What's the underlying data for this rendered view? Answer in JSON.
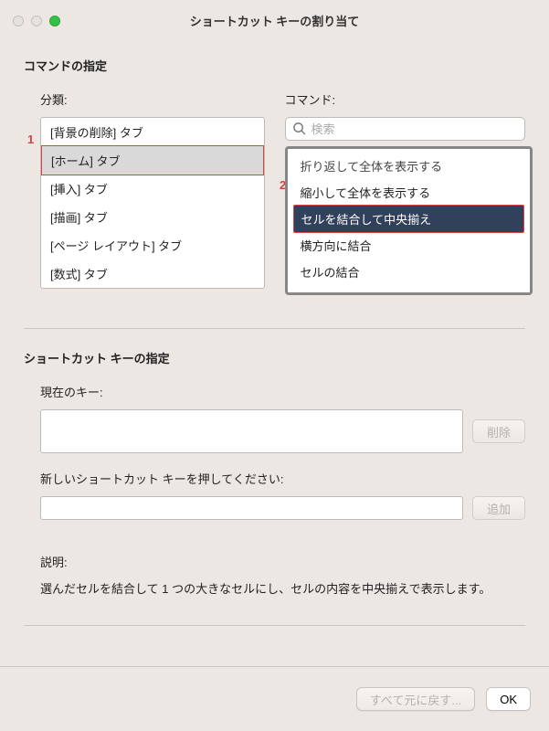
{
  "window": {
    "title": "ショートカット キーの割り当て"
  },
  "section_command": {
    "title": "コマンドの指定",
    "category_label": "分類:",
    "command_label": "コマンド:",
    "categories": [
      "[背景の削除] タブ",
      "[ホーム] タブ",
      "[挿入] タブ",
      "[描画] タブ",
      "[ページ レイアウト] タブ",
      "[数式] タブ"
    ],
    "selected_category_index": 1
  },
  "search": {
    "placeholder": "検索",
    "value": ""
  },
  "commands": {
    "items": [
      "折り返して全体を表示する",
      "縮小して全体を表示する",
      "セルを結合して中央揃え",
      "横方向に結合",
      "セルの結合"
    ],
    "selected_index": 2
  },
  "markers": {
    "one": "1",
    "two": "2"
  },
  "section_shortcut": {
    "title": "ショートカット キーの指定",
    "current_label": "現在のキー:",
    "delete_btn": "削除",
    "press_label": "新しいショートカット キーを押してください:",
    "add_btn": "追加"
  },
  "description": {
    "label": "説明:",
    "text": "選んだセルを結合して 1 つの大きなセルにし、セルの内容を中央揃えで表示します。"
  },
  "footer": {
    "reset": "すべて元に戻す...",
    "ok": "OK"
  }
}
